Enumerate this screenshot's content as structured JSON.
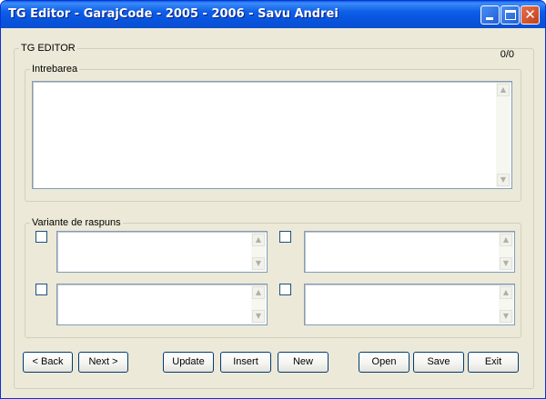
{
  "window": {
    "title": "TG Editor - GarajCode - 2005 - 2006 - Savu Andrei",
    "controls": {
      "minimize": "minimize-icon",
      "maximize": "maximize-icon",
      "close": "✕"
    }
  },
  "main_group": {
    "legend": "TG EDITOR",
    "counter": "0/0"
  },
  "question_group": {
    "legend": "Intrebarea",
    "text": ""
  },
  "answers_group": {
    "legend": "Variante de raspuns",
    "answers": [
      {
        "checked": false,
        "text": ""
      },
      {
        "checked": false,
        "text": ""
      },
      {
        "checked": false,
        "text": ""
      },
      {
        "checked": false,
        "text": ""
      }
    ]
  },
  "buttons": {
    "back": "< Back",
    "next": "Next >",
    "update": "Update",
    "insert": "Insert",
    "new": "New",
    "open": "Open",
    "save": "Save",
    "exit": "Exit"
  },
  "colors": {
    "titlebar": "#0854dd",
    "window_bg": "#ece9d8",
    "button_border": "#003c74",
    "field_border": "#7f9db9"
  }
}
